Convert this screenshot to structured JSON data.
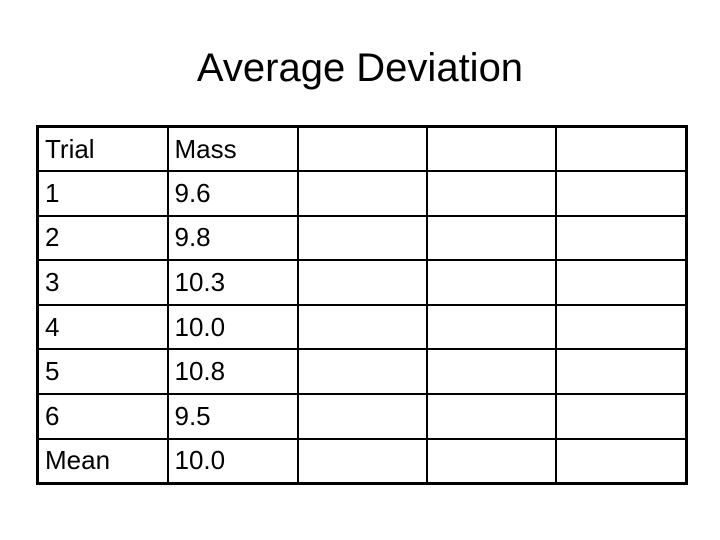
{
  "slide": {
    "title": "Average Deviation"
  },
  "table": {
    "rows": [
      [
        "Trial",
        "Mass",
        "",
        "",
        ""
      ],
      [
        "1",
        "9.6",
        "",
        "",
        ""
      ],
      [
        "2",
        "9.8",
        "",
        "",
        ""
      ],
      [
        "3",
        "10.3",
        "",
        "",
        ""
      ],
      [
        "4",
        "10.0",
        "",
        "",
        ""
      ],
      [
        "5",
        "10.8",
        "",
        "",
        ""
      ],
      [
        "6",
        "9.5",
        "",
        "",
        ""
      ],
      [
        "Mean",
        "10.0",
        "",
        "",
        ""
      ]
    ]
  }
}
